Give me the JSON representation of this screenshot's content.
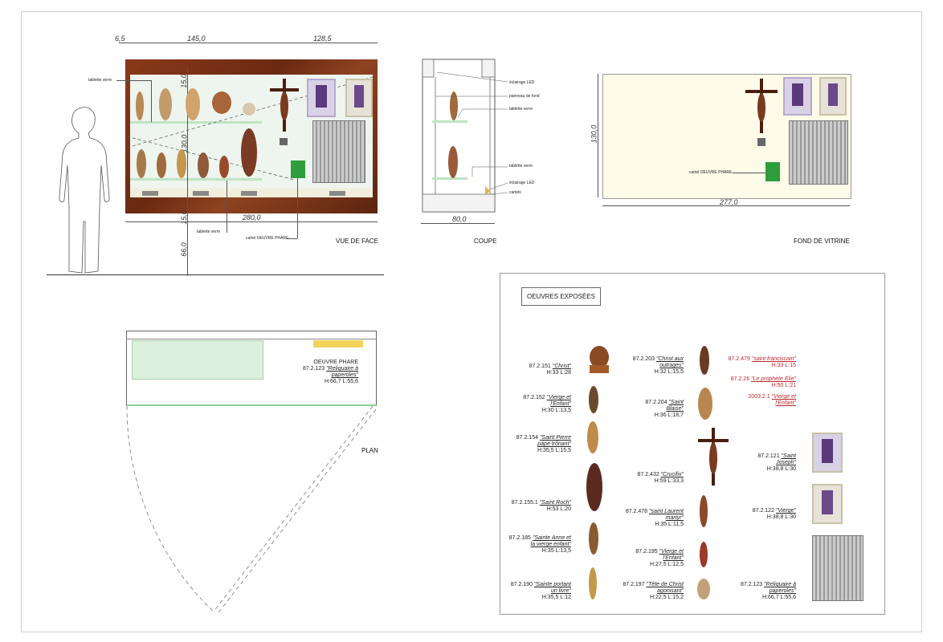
{
  "front": {
    "dims": {
      "left": "6,5",
      "a": "145,0",
      "b": "128,5",
      "top_h": "15,0",
      "mid_h": "130,0",
      "bot_h": "15,0",
      "width": "280,0",
      "floor": "66,0"
    },
    "labels": {
      "tablette_top": "tablette verre",
      "tablette_bottom": "tablette verre",
      "cartel": "cartel OEUVRE PHARE"
    },
    "title": "VUE DE FACE"
  },
  "coupe": {
    "labels": {
      "eclairage1": "éclairage LED",
      "panneau": "panneau de fond",
      "tablette1": "tablette verre",
      "tablette2": "tablette verre",
      "eclairage2": "éclairage LED",
      "cartels": "cartels"
    },
    "width": "80,0",
    "title": "COUPE"
  },
  "fond": {
    "height": "130,0",
    "width": "277,0",
    "cartel": "cartel OEUVRE PHARE",
    "title": "FOND DE VITRINE"
  },
  "plan": {
    "phare": "OEUVRE PHARE",
    "num": "87.2.123",
    "name": "\"Reliquaire à paperoles\"",
    "size": "H:66,7 L:55,6",
    "title": "PLAN"
  },
  "oeuvres": {
    "header": "OEUVRES EXPOSÉES",
    "col1": [
      {
        "num": "87.2.151",
        "name": "\"Christ\"",
        "size": "H:33 L:28"
      },
      {
        "num": "87.2.152",
        "name": "\"Vierge et l'Enfant\"",
        "size": "H:30 L:13,5"
      },
      {
        "num": "87.2.154",
        "name": "\"Saint Pierre pape trônant\"",
        "size": "H:35,5 L:15,5"
      },
      {
        "num": "87.2.155.1",
        "name": "\"Saint Roch\"",
        "size": "H:53 L:20"
      },
      {
        "num": "87.2.185",
        "name": "\"Sainte Anne et la vierge enfant\"",
        "size": "H:35 L:13,5"
      },
      {
        "num": "87.2.190",
        "name": "\"Sainte portant un livre\"",
        "size": "H:35,5 L:12"
      }
    ],
    "col2": [
      {
        "num": "87.2.203",
        "name": "\"Christ aux outrages\"",
        "size": "H:32 L:15,5"
      },
      {
        "num": "87.2.204",
        "name": "\"Saint Blaise\"",
        "size": "H:36 L:18,7"
      },
      {
        "num": "87.2.432",
        "name": "\"Crucifix\"",
        "size": "H:59 L:33,3"
      },
      {
        "num": "87.2.478",
        "name": "\"saint Laurent martyr\"",
        "size": "H:35 L:11,5"
      },
      {
        "num": "87.2.195",
        "name": "\"Vierge et l'Enfant\"",
        "size": "H:27,5 L:12,5"
      },
      {
        "num": "87.2.197",
        "name": "\"Tête de Christ agonisant\"",
        "size": "H:22,5 L:15,2"
      }
    ],
    "col3": [
      {
        "num": "87.2.479",
        "name": "\"saint franciscain\"",
        "size": "H:33 L:15"
      },
      {
        "num": "87.2.26",
        "name": "\"Le prophète Elie\"",
        "size": "H:50 L:21"
      },
      {
        "num": "2003.2.1",
        "name": "\"Vierge et l'Enfant\"",
        "size": ""
      },
      {
        "num": "87.2.121",
        "name": "\"Saint Joseph\"",
        "size": "H:38,8 L:30"
      },
      {
        "num": "87.2.122",
        "name": "\"Vierge\"",
        "size": "H:38,8 L:30"
      },
      {
        "num": "87.2.123",
        "name": "\"Reliquaire à paperoles\"",
        "size": "H:66,7 L:55,6"
      }
    ]
  },
  "colors": {
    "wood": "#7a3016",
    "glass_back": "#eef4ee",
    "shelf": "#bfe3c4",
    "fond": "#fefbe8",
    "cartel_green": "#2e9e3c",
    "red": "#c0262b"
  }
}
